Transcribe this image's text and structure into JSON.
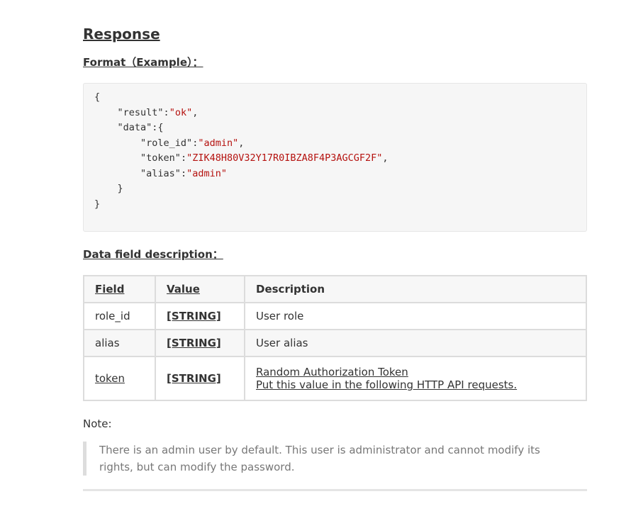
{
  "headings": {
    "response": "Response",
    "format": "Format（Example）：",
    "data_fields": "Data field description："
  },
  "code_example": {
    "open_brace": "{",
    "result_key": "\"result\"",
    "result_value": "\"ok\"",
    "data_key": "\"data\"",
    "role_id_key": "\"role_id\"",
    "role_id_value": "\"admin\"",
    "token_key": "\"token\"",
    "token_value": "\"ZIK48H80V32Y17R0IBZA8F4P3AGCGF2F\"",
    "alias_key": "\"alias\"",
    "alias_value": "\"admin\"",
    "inner_close": "}",
    "close_brace": "}"
  },
  "table": {
    "headers": {
      "field": "Field",
      "value": "Value",
      "description": "Description"
    },
    "rows": [
      {
        "field": "role_id",
        "value": "[STRING]",
        "description": "User role"
      },
      {
        "field": "alias",
        "value": "[STRING]",
        "description": "User alias"
      },
      {
        "field": "token",
        "value": "[STRING]",
        "description_line1": "Random Authorization Token",
        "description_line2": "Put this value in the following HTTP API requests."
      }
    ]
  },
  "note": {
    "label": "Note:",
    "text": "There is an admin user by default. This user is administrator and cannot modify its rights, but can modify the password."
  },
  "colors": {
    "string_literal": "#b5120f",
    "code_background": "#f6f6f6",
    "quote_text": "#777777"
  }
}
